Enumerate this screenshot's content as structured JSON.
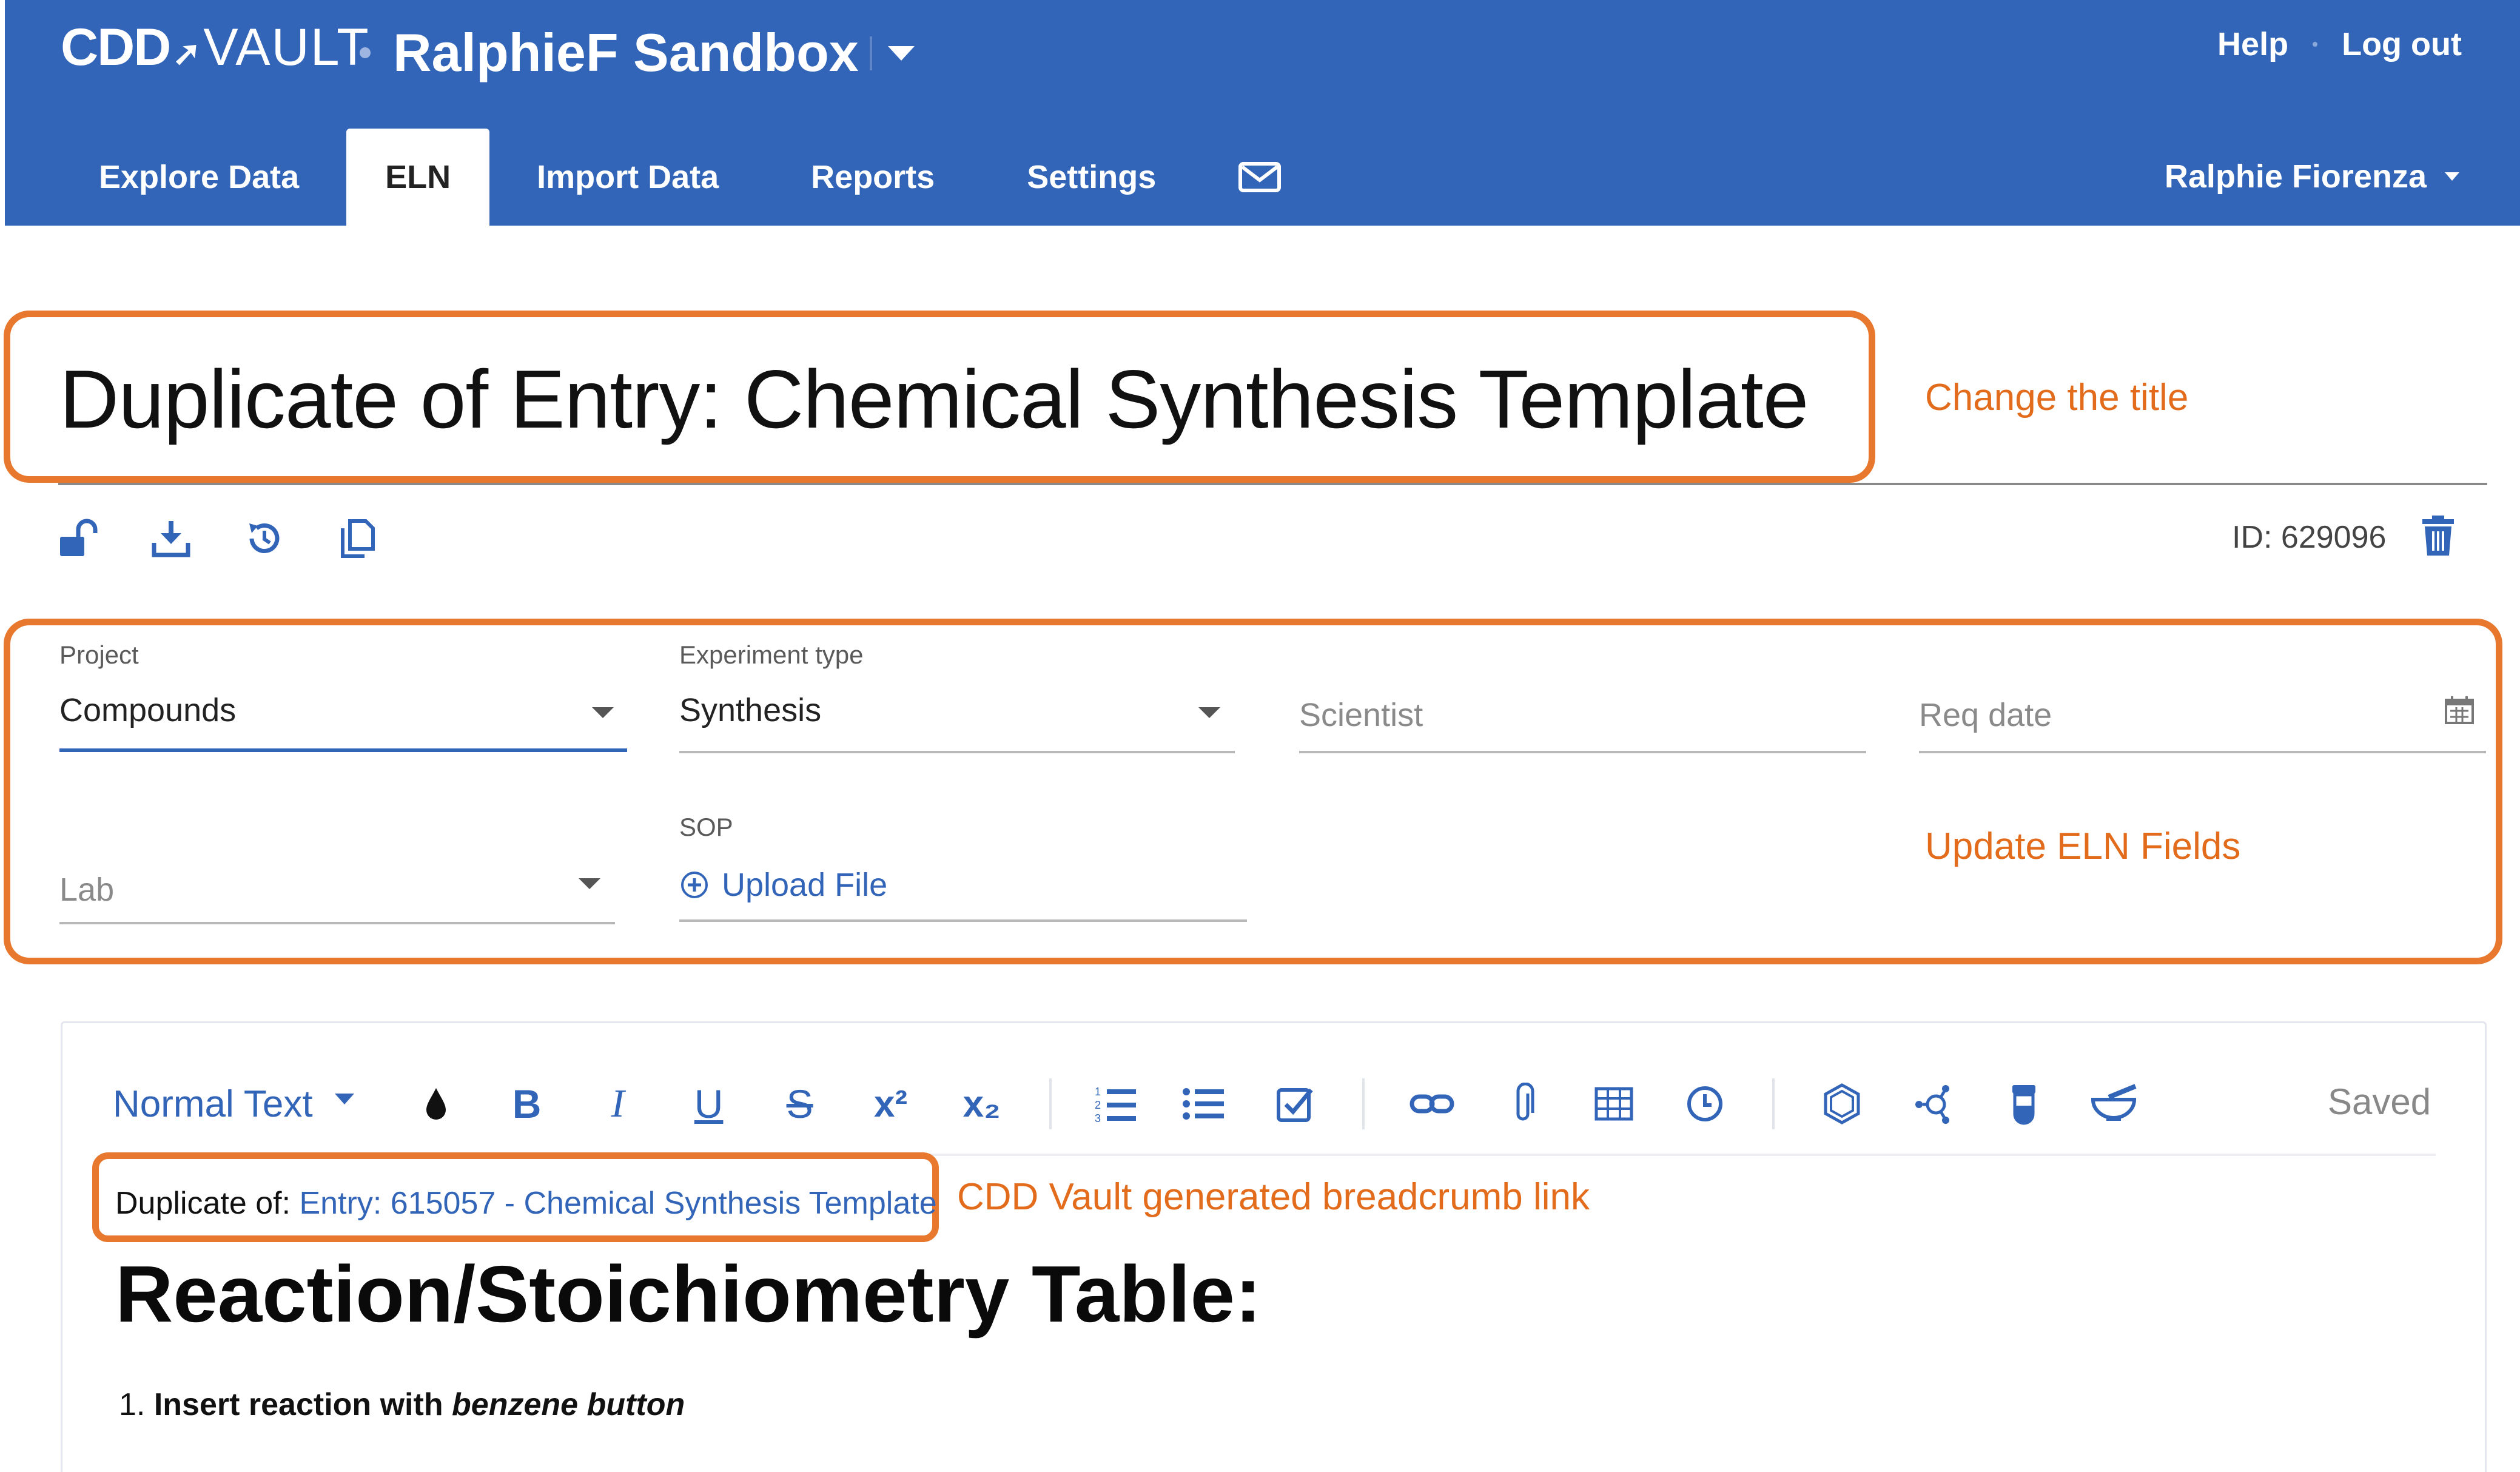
{
  "header": {
    "logo_cdd": "CDD",
    "logo_vault": "VAULT",
    "vault_name": "RalphieF Sandbox",
    "help_label": "Help",
    "logout_label": "Log out",
    "user_name": "Ralphie Fiorenza",
    "bg_color": "#3265b8"
  },
  "nav": {
    "tabs": [
      {
        "label": "Explore Data"
      },
      {
        "label": "ELN"
      },
      {
        "label": "Import Data"
      },
      {
        "label": "Reports"
      },
      {
        "label": "Settings"
      }
    ],
    "active_tab": "ELN",
    "mail_icon": "mail-icon"
  },
  "entry": {
    "title": "Duplicate of Entry: Chemical Synthesis Template",
    "id_text": "ID: 629096",
    "tools": [
      "unlock-icon",
      "download-icon",
      "history-icon",
      "duplicate-icon"
    ]
  },
  "fields": {
    "project": {
      "label": "Project",
      "value": "Compounds"
    },
    "experiment_type": {
      "label": "Experiment type",
      "value": "Synthesis"
    },
    "scientist": {
      "placeholder": "Scientist"
    },
    "req_date": {
      "placeholder": "Req date"
    },
    "lab": {
      "placeholder": "Lab"
    },
    "sop": {
      "label": "SOP",
      "upload_label": "Upload File"
    }
  },
  "annotations": {
    "title_note": "Change the title",
    "fields_note": "Update ELN Fields",
    "breadcrumb_note": "CDD Vault generated breadcrumb link",
    "color": "#e8782e"
  },
  "editor": {
    "style_select": "Normal Text",
    "status": "Saved",
    "breadcrumb_prefix": "Duplicate of: ",
    "breadcrumb_link": "Entry: 615057 - Chemical Synthesis Template",
    "heading": "Reaction/Stoichiometry Table:",
    "list_number": "1. ",
    "list_item_bold": "Insert reaction with ",
    "list_item_italic": "benzene button"
  }
}
